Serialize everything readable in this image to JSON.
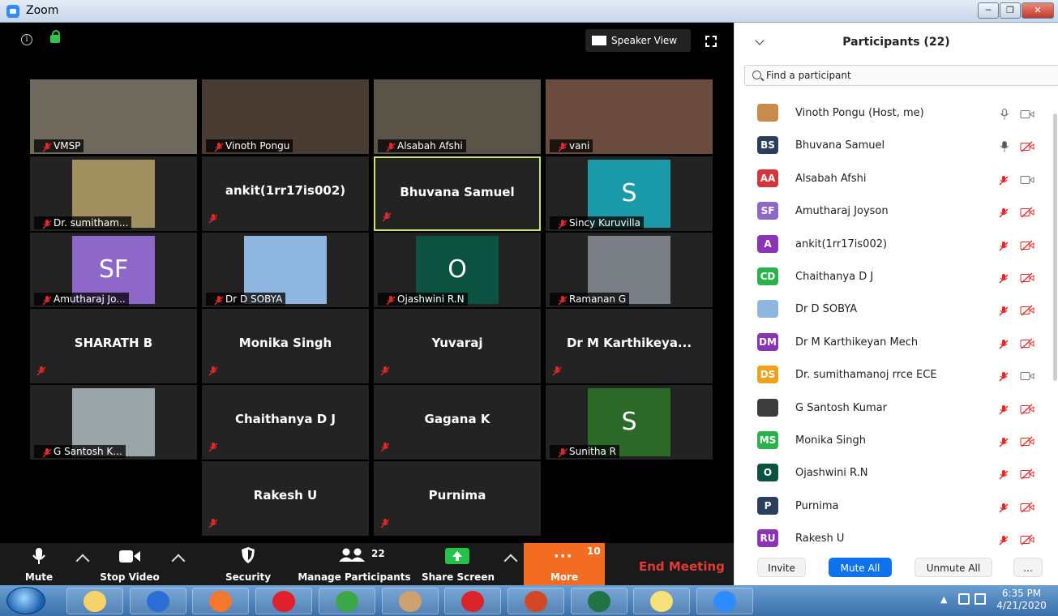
{
  "window": {
    "title": "Zoom"
  },
  "meeting": {
    "speaker_view_label": "Speaker View",
    "tiles": [
      {
        "name": "VMSP",
        "kind": "video",
        "bg": "#6f6a5c"
      },
      {
        "name": "Vinoth Pongu",
        "kind": "video",
        "bg": "#4a3b33"
      },
      {
        "name": "Alsabah Afshi",
        "kind": "video",
        "bg": "#5a5448"
      },
      {
        "name": "vani",
        "kind": "video",
        "bg": "#6b4b3d"
      },
      {
        "name": "Dr. sumitham...",
        "kind": "video-small",
        "bg": "#a09060"
      },
      {
        "name": "ankit(1rr17is002)",
        "kind": "name",
        "bg": ""
      },
      {
        "name": "Bhuvana Samuel",
        "kind": "name-active",
        "bg": ""
      },
      {
        "name": "Sincy Kuruvilla",
        "kind": "letter",
        "letter": "S",
        "bg": "#1a9aa8"
      },
      {
        "name": "Amutharaj Jo...",
        "kind": "letter",
        "letter": "SF",
        "bg": "#8e68c9"
      },
      {
        "name": "Dr D SOBYA",
        "kind": "video-small",
        "bg": "#8fb6de"
      },
      {
        "name": "Ojashwini R.N",
        "kind": "letter",
        "letter": "O",
        "bg": "#0c5240"
      },
      {
        "name": "Ramanan G",
        "kind": "video-small",
        "bg": "#7a7f86"
      },
      {
        "name": "SHARATH B",
        "kind": "name",
        "bg": ""
      },
      {
        "name": "Monika Singh",
        "kind": "name",
        "bg": ""
      },
      {
        "name": "Yuvaraj",
        "kind": "name",
        "bg": ""
      },
      {
        "name": "Dr M Karthikeya...",
        "kind": "name",
        "bg": ""
      },
      {
        "name": "G Santosh K...",
        "kind": "video-small",
        "bg": "#9aa5a8"
      },
      {
        "name": "Chaithanya D J",
        "kind": "name",
        "bg": ""
      },
      {
        "name": "Gagana K",
        "kind": "name",
        "bg": ""
      },
      {
        "name": "Sunitha R",
        "kind": "letter",
        "letter": "S",
        "bg": "#2d6a2a"
      },
      {
        "name": "Rakesh U",
        "kind": "name",
        "bg": ""
      },
      {
        "name": "Purnima",
        "kind": "name",
        "bg": ""
      }
    ]
  },
  "toolbar": {
    "mute": "Mute",
    "stop_video": "Stop Video",
    "security": "Security",
    "manage_participants": "Manage Participants",
    "participants_count": "22",
    "share_screen": "Share Screen",
    "more": "More",
    "more_badge": "10",
    "end_meeting": "End Meeting"
  },
  "participants": {
    "title": "Participants (22)",
    "search_placeholder": "Find a participant",
    "items": [
      {
        "name": "Vinoth Pongu (Host, me)",
        "initials": "",
        "color": "#c98a4a",
        "mic": "on",
        "video": "on"
      },
      {
        "name": "Bhuvana Samuel",
        "initials": "BS",
        "color": "#2b3f5c",
        "mic": "active",
        "video": "off"
      },
      {
        "name": "Alsabah Afshi",
        "initials": "AA",
        "color": "#d6333a",
        "mic": "off",
        "video": "on"
      },
      {
        "name": "Amutharaj Joyson",
        "initials": "SF",
        "color": "#8e68c9",
        "mic": "off",
        "video": "off"
      },
      {
        "name": "ankit(1rr17is002)",
        "initials": "A",
        "color": "#8a35b6",
        "mic": "off",
        "video": "off"
      },
      {
        "name": "Chaithanya D J",
        "initials": "CD",
        "color": "#2bb24c",
        "mic": "off",
        "video": "off"
      },
      {
        "name": "Dr D SOBYA",
        "initials": "",
        "color": "#8fb6de",
        "mic": "off",
        "video": "off"
      },
      {
        "name": "Dr M Karthikeyan Mech",
        "initials": "DM",
        "color": "#8a35b6",
        "mic": "off",
        "video": "off"
      },
      {
        "name": "Dr. sumithamanoj rrce ECE",
        "initials": "DS",
        "color": "#f0a019",
        "mic": "off",
        "video": "on"
      },
      {
        "name": "G Santosh Kumar",
        "initials": "",
        "color": "#3c3c3c",
        "mic": "off",
        "video": "off"
      },
      {
        "name": "Monika Singh",
        "initials": "MS",
        "color": "#2bb24c",
        "mic": "off",
        "video": "off"
      },
      {
        "name": "Ojashwini R.N",
        "initials": "O",
        "color": "#0c5240",
        "mic": "off",
        "video": "off"
      },
      {
        "name": "Purnima",
        "initials": "P",
        "color": "#2b3f5c",
        "mic": "off",
        "video": "off"
      },
      {
        "name": "Rakesh U",
        "initials": "RU",
        "color": "#8a35b6",
        "mic": "off",
        "video": "off"
      }
    ],
    "buttons": {
      "invite": "Invite",
      "mute_all": "Mute All",
      "unmute_all": "Unmute All",
      "more": "..."
    }
  },
  "taskbar": {
    "time": "6:35 PM",
    "date": "4/21/2020",
    "apps": [
      "file-explorer-icon",
      "swipe-app-icon",
      "firefox-icon",
      "opera-icon",
      "chrome-icon",
      "paint-icon",
      "acrobat-icon",
      "powerpoint-icon",
      "excel-icon",
      "sticky-notes-icon",
      "zoom-icon"
    ]
  }
}
